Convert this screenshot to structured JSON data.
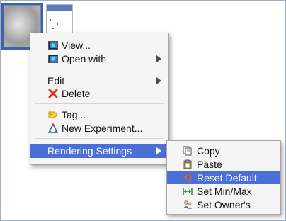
{
  "menu": {
    "items": {
      "view": "View...",
      "open_with": "Open with",
      "edit": "Edit",
      "delete": "Delete",
      "tag": "Tag...",
      "new_experiment": "New Experiment...",
      "rendering_settings": "Rendering Settings"
    }
  },
  "submenu": {
    "items": {
      "copy": "Copy",
      "paste": "Paste",
      "reset_default": "Reset Default",
      "set_min_max": "Set Min/Max",
      "set_owners": "Set Owner's"
    }
  },
  "colors": {
    "highlight": "#4a6fd6",
    "selection_border": "#3f62ad",
    "delete_icon": "#d9342b"
  }
}
